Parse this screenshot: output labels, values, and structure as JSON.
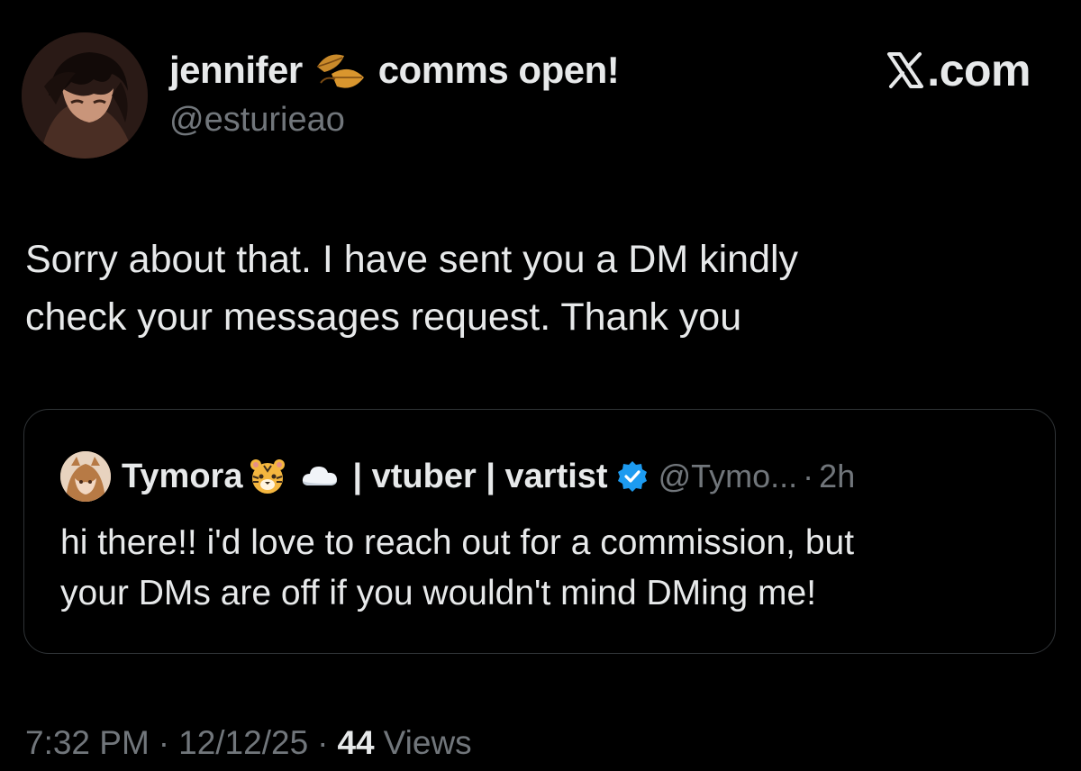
{
  "author": {
    "display_name": "jennifer",
    "display_name_suffix": "comms open!",
    "handle": "@esturieao",
    "name_emoji_icon": "fallen-leaf-icon"
  },
  "brand": {
    "text": ".com",
    "logo_icon": "x-logo-icon"
  },
  "tweet": {
    "lines": [
      "Sorry about that. I have sent you a DM kindly",
      "check your messages request. Thank you"
    ]
  },
  "quoted_tweet": {
    "display_name": "Tymora",
    "display_name_suffix": "| vtuber | vartist",
    "emojis": [
      "tiger-face-icon",
      "cloud-icon"
    ],
    "verified_icon": "verified-badge-icon",
    "handle": "@Tymo...",
    "separator": "·",
    "time": "2h",
    "lines": [
      "hi there!! i'd love to reach out for a commission, but",
      "your DMs are off if you wouldn't mind DMing me!"
    ]
  },
  "footer": {
    "time": "7:32 PM",
    "separator": "·",
    "date": "12/12/25",
    "views_count": "44",
    "views_label": "Views"
  },
  "colors": {
    "background": "#000000",
    "text_primary": "#e7e9ea",
    "text_secondary": "#71767b",
    "border": "#2f3336",
    "verified_blue": "#1d9bf0"
  }
}
